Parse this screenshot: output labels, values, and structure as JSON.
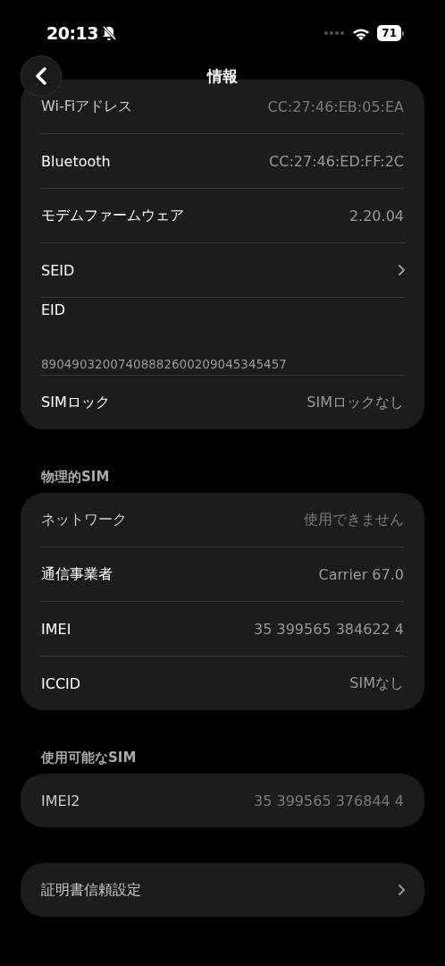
{
  "status_bar": {
    "time": "20:13",
    "battery": "71"
  },
  "nav": {
    "title": "情報"
  },
  "sections": [
    {
      "rows": [
        {
          "kind": "value",
          "label": "Wi-Fiアドレス",
          "value": "CC:27:46:EB:05:EA"
        },
        {
          "kind": "value",
          "label": "Bluetooth",
          "value": "CC:27:46:ED:FF:2C"
        },
        {
          "kind": "value",
          "label": "モデムファームウェア",
          "value": "2.20.04"
        },
        {
          "kind": "link",
          "label": "SEID"
        },
        {
          "kind": "stacked",
          "label": "EID",
          "value": "89049032007408882600209045345457"
        },
        {
          "kind": "value",
          "label": "SIMロック",
          "value": "SIMロックなし"
        }
      ]
    },
    {
      "header": "物理的SIM",
      "rows": [
        {
          "kind": "value",
          "label": "ネットワーク",
          "value": "使用できません"
        },
        {
          "kind": "value",
          "label": "通信事業者",
          "value": "Carrier 67.0"
        },
        {
          "kind": "value",
          "label": "IMEI",
          "value": "35 399565 384622 4"
        },
        {
          "kind": "value",
          "label": "ICCID",
          "value": "SIMなし"
        }
      ]
    },
    {
      "header": "使用可能なSIM",
      "rows": [
        {
          "kind": "value",
          "label": "IMEI2",
          "value": "35 399565 376844 4"
        }
      ]
    },
    {
      "rows": [
        {
          "kind": "link",
          "label": "証明書信頼設定"
        }
      ]
    }
  ]
}
